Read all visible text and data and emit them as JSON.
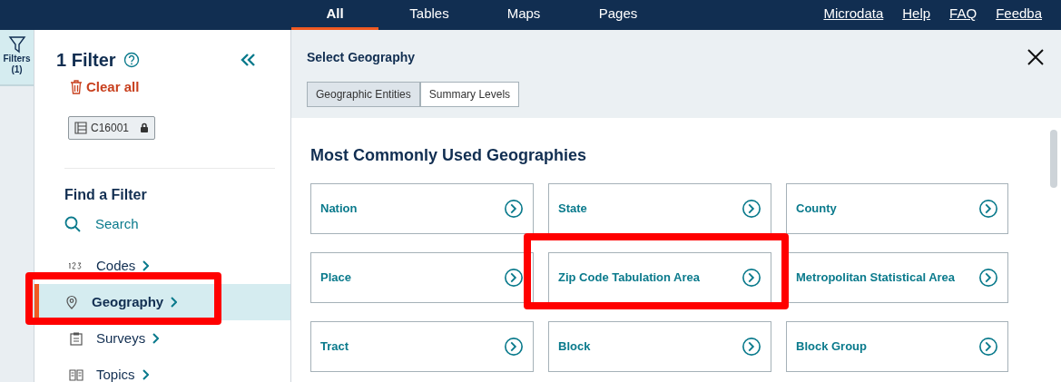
{
  "top_nav": {
    "tabs": [
      {
        "label": "All",
        "selected": true
      },
      {
        "label": "Tables",
        "selected": false
      },
      {
        "label": "Maps",
        "selected": false
      },
      {
        "label": "Pages",
        "selected": false
      }
    ],
    "links": [
      "Microdata",
      "Help",
      "FAQ",
      "Feedba"
    ]
  },
  "rail": {
    "label": "Filters",
    "count": "(1)"
  },
  "filter_panel": {
    "title": "1 Filter",
    "clear_label": "Clear all",
    "chips": [
      {
        "label": "C16001",
        "locked": true
      }
    ],
    "find_title": "Find a Filter",
    "search_label": "Search",
    "items": [
      {
        "label": "Codes",
        "selected": false
      },
      {
        "label": "Geography",
        "selected": true
      },
      {
        "label": "Surveys",
        "selected": false
      },
      {
        "label": "Topics",
        "selected": false
      }
    ]
  },
  "geography": {
    "title": "Select Geography",
    "toggle": [
      {
        "label": "Geographic Entities",
        "selected": true
      },
      {
        "label": "Summary Levels",
        "selected": false
      }
    ],
    "section_title": "Most Commonly Used Geographies",
    "options": [
      "Nation",
      "State",
      "County",
      "Place",
      "Zip Code Tabulation Area",
      "Metropolitan Statistical Area",
      "Tract",
      "Block",
      "Block Group"
    ]
  }
}
